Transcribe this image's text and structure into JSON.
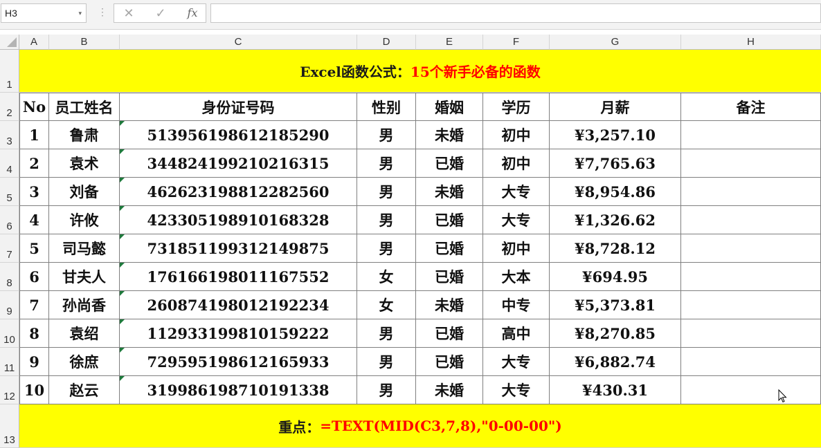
{
  "formula_bar": {
    "name_box": "H3",
    "dropdown_glyph": "▾",
    "separator_glyph": "⋮",
    "cancel_glyph": "✕",
    "enter_glyph": "✓",
    "fx_label": "fx",
    "formula": ""
  },
  "columns": [
    "A",
    "B",
    "C",
    "D",
    "E",
    "F",
    "G",
    "H"
  ],
  "rows": [
    "1",
    "2",
    "3",
    "4",
    "5",
    "6",
    "7",
    "8",
    "9",
    "10",
    "11",
    "12",
    "13"
  ],
  "title": {
    "prefix": "Excel函数公式：",
    "main": "15个新手必备的函数"
  },
  "table": {
    "headers": [
      "No",
      "员工姓名",
      "身份证号码",
      "性别",
      "婚姻",
      "学历",
      "月薪",
      "备注"
    ],
    "rows": [
      [
        "1",
        "鲁肃",
        "513956198612185290",
        "男",
        "未婚",
        "初中",
        "¥3,257.10",
        ""
      ],
      [
        "2",
        "袁术",
        "344824199210216315",
        "男",
        "已婚",
        "初中",
        "¥7,765.63",
        ""
      ],
      [
        "3",
        "刘备",
        "462623198812282560",
        "男",
        "未婚",
        "大专",
        "¥8,954.86",
        ""
      ],
      [
        "4",
        "许攸",
        "423305198910168328",
        "男",
        "已婚",
        "大专",
        "¥1,326.62",
        ""
      ],
      [
        "5",
        "司马懿",
        "731851199312149875",
        "男",
        "已婚",
        "初中",
        "¥8,728.12",
        ""
      ],
      [
        "6",
        "甘夫人",
        "176166198011167552",
        "女",
        "已婚",
        "大本",
        "¥694.95",
        ""
      ],
      [
        "7",
        "孙尚香",
        "260874198012192234",
        "女",
        "未婚",
        "中专",
        "¥5,373.81",
        ""
      ],
      [
        "8",
        "袁绍",
        "112933199810159222",
        "男",
        "已婚",
        "高中",
        "¥8,270.85",
        ""
      ],
      [
        "9",
        "徐庶",
        "729595198612165933",
        "男",
        "已婚",
        "大专",
        "¥6,882.74",
        ""
      ],
      [
        "10",
        "赵云",
        "319986198710191338",
        "男",
        "未婚",
        "大专",
        "¥430.31",
        ""
      ]
    ]
  },
  "footer": {
    "prefix": "重点：",
    "formula": "=TEXT(MID(C3,7,8),\"0-00-00\")"
  },
  "colors": {
    "banner": "#ffff00",
    "accent_red": "#ff0000",
    "id_marker": "#1e7a3c"
  }
}
